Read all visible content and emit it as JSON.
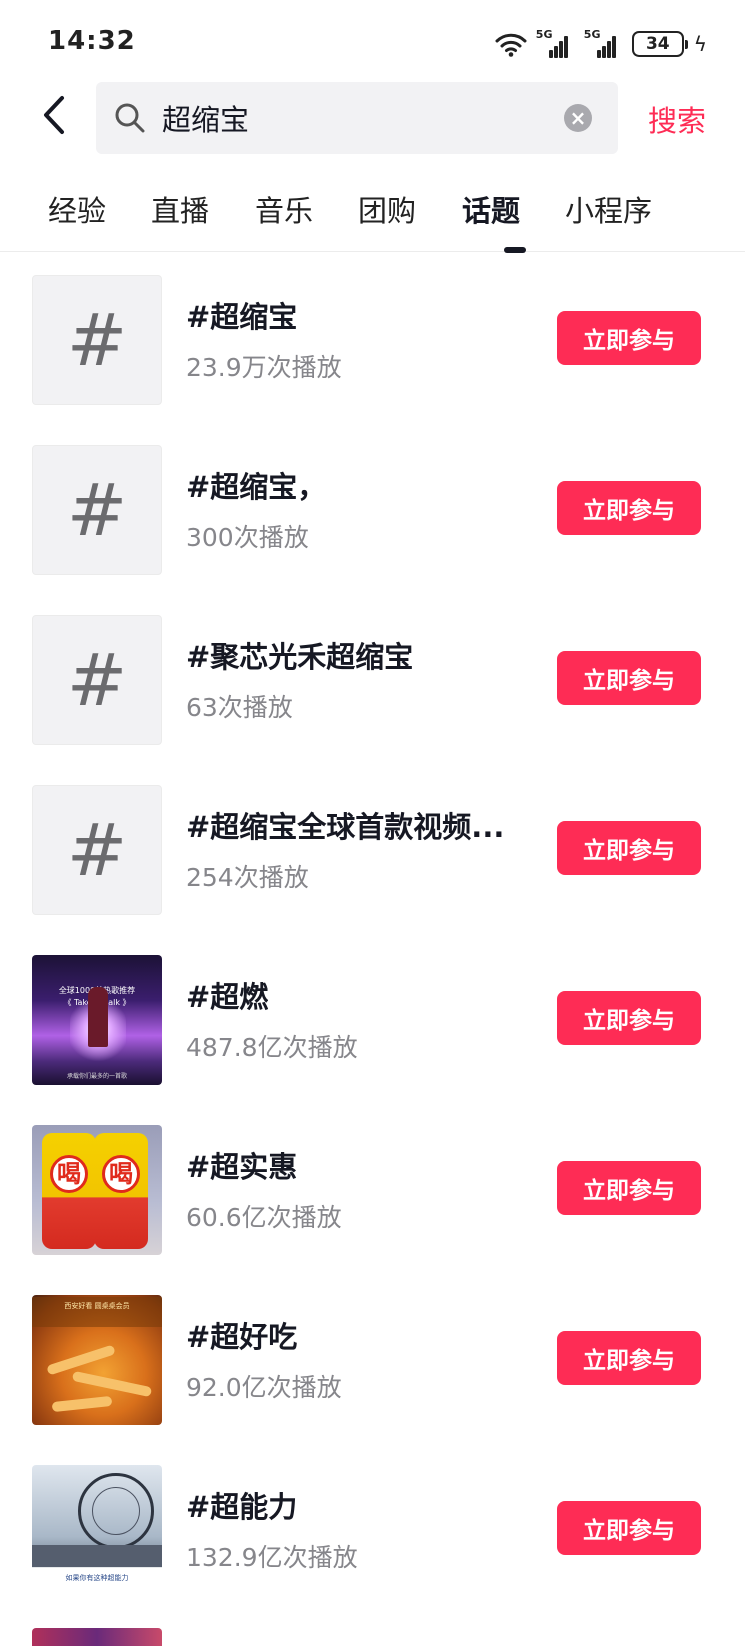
{
  "status_bar": {
    "time": "14:32",
    "network_1": "5G",
    "network_2": "5G",
    "battery": "34"
  },
  "header": {
    "back_icon": "chevron-left-icon",
    "search_value": "超缩宝",
    "search_button": "搜索"
  },
  "tabs": [
    {
      "label": "经验",
      "active": false
    },
    {
      "label": "直播",
      "active": false
    },
    {
      "label": "音乐",
      "active": false
    },
    {
      "label": "团购",
      "active": false
    },
    {
      "label": "话题",
      "active": true
    },
    {
      "label": "小程序",
      "active": false
    }
  ],
  "topics": [
    {
      "title": "#超缩宝",
      "plays": "23.9万次播放",
      "thumb": "hash-icon",
      "button": "立即参与"
    },
    {
      "title": "#超缩宝，",
      "plays": "300次播放",
      "thumb": "hash-icon",
      "button": "立即参与"
    },
    {
      "title": "#聚芯光禾超缩宝",
      "plays": "63次播放",
      "thumb": "hash-icon",
      "button": "立即参与"
    },
    {
      "title": "#超缩宝全球首款视频...",
      "plays": "254次播放",
      "thumb": "hash-icon",
      "button": "立即参与"
    },
    {
      "title": "#超燃",
      "plays": "487.8亿次播放",
      "thumb": "image",
      "button": "立即参与",
      "thumb_text_1": "全球1000首热歌推荐",
      "thumb_text_2": "《 Take a walk 》",
      "thumb_text_3": "承载你们最多的一首歌"
    },
    {
      "title": "#超实惠",
      "plays": "60.6亿次播放",
      "thumb": "image",
      "button": "立即参与",
      "thumb_text_1": "喝",
      "thumb_text_2": "喝"
    },
    {
      "title": "#超好吃",
      "plays": "92.0亿次播放",
      "thumb": "image",
      "button": "立即参与",
      "thumb_text_1": "西安好看 圆桌桌会员"
    },
    {
      "title": "#超能力",
      "plays": "132.9亿次播放",
      "thumb": "image",
      "button": "立即参与",
      "thumb_text_1": "如果你有这种超能力"
    }
  ],
  "colors": {
    "accent": "#fe2c55",
    "text_primary": "#161823",
    "text_secondary": "#86868b",
    "search_bg": "#f2f2f4"
  }
}
